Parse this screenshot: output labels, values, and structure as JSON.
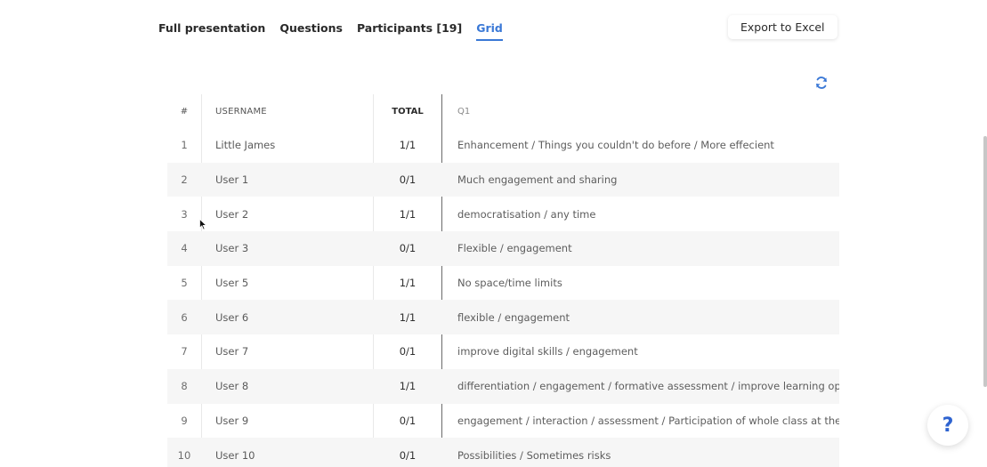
{
  "tabs": [
    {
      "label": "Full presentation"
    },
    {
      "label": "Questions"
    },
    {
      "label": "Participants [19]"
    },
    {
      "label": "Grid"
    }
  ],
  "active_tab": "Grid",
  "export_label": "Export to Excel",
  "refresh_icon": "refresh-icon",
  "help_label": "?",
  "accent_color": "#3a78d6",
  "grid": {
    "headers": {
      "num": "#",
      "username": "USERNAME",
      "total": "TOTAL",
      "q1": "Q1"
    },
    "rows": [
      {
        "num": "1",
        "username": "Little James",
        "total": "1/1",
        "q1": "Enhancement / Things you couldn't do before / More effecient"
      },
      {
        "num": "2",
        "username": "User 1",
        "total": "0/1",
        "q1": "Much engagement and sharing"
      },
      {
        "num": "3",
        "username": "User 2",
        "total": "1/1",
        "q1": "democratisation / any time"
      },
      {
        "num": "4",
        "username": "User 3",
        "total": "0/1",
        "q1": "Flexible / engagement"
      },
      {
        "num": "5",
        "username": "User 5",
        "total": "1/1",
        "q1": "No space/time limits"
      },
      {
        "num": "6",
        "username": "User 6",
        "total": "1/1",
        "q1": "flexible / engagement"
      },
      {
        "num": "7",
        "username": "User 7",
        "total": "0/1",
        "q1": "improve digital skills / engagement"
      },
      {
        "num": "8",
        "username": "User 8",
        "total": "1/1",
        "q1": "differentiation / engagement / formative assessment / improve learning opportuniti"
      },
      {
        "num": "9",
        "username": "User 9",
        "total": "0/1",
        "q1": "engagement / interaction / assessment / Participation of whole class at the same tii"
      },
      {
        "num": "10",
        "username": "User 10",
        "total": "0/1",
        "q1": "Possibilities / Sometimes risks"
      }
    ]
  }
}
